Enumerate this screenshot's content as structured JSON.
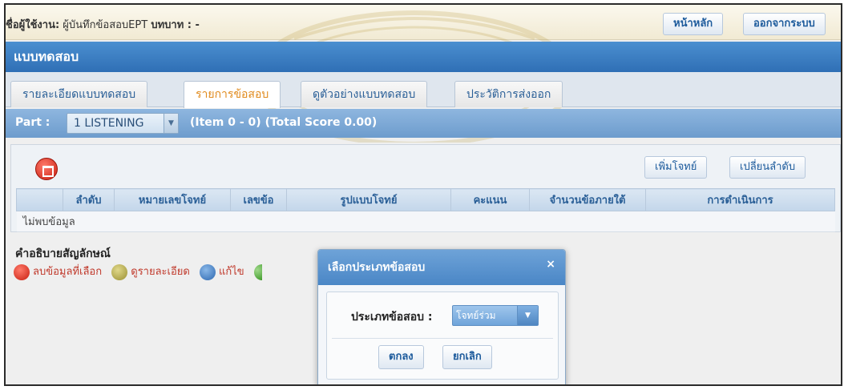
{
  "header": {
    "user_label": "ชื่อผู้ใช้งาน:",
    "user_name": "ผู้บันทึกข้อสอบEPT",
    "role_label": "บทบาท : -",
    "home_label": "หน้าหลัก",
    "logout_label": "ออกจากระบบ"
  },
  "page_title": "แบบทดสอบ",
  "tabs": [
    {
      "label": "รายละเอียดแบบทดสอบ",
      "active": false
    },
    {
      "label": "รายการข้อสอบ",
      "active": true
    },
    {
      "label": "ดูตัวอย่างแบบทดสอบ",
      "active": false
    },
    {
      "label": "ประวัติการส่งออก",
      "active": false
    }
  ],
  "part": {
    "label": "Part :",
    "selected": "1 LISTENING",
    "info": "(Item 0 - 0) (Total Score 0.00)"
  },
  "toolbar": {
    "add_label": "เพิ่มโจทย์",
    "reorder_label": "เปลี่ยนลำดับ"
  },
  "table": {
    "columns": [
      "",
      "ลำดับ",
      "หมายเลขโจทย์",
      "เลขข้อ",
      "รูปแบบโจทย์",
      "คะแนน",
      "จำนวนข้อภายใต้",
      "การดำเนินการ"
    ],
    "empty_text": "ไม่พบข้อมูล"
  },
  "legend": {
    "title": "คำอธิบายสัญลักษณ์",
    "items": [
      {
        "icon": "delete-icon",
        "label": "ลบข้อมูลที่เลือก"
      },
      {
        "icon": "view-details-icon",
        "label": "ดูรายละเอียด"
      },
      {
        "icon": "edit-icon",
        "label": "แก้ไข"
      }
    ]
  },
  "modal": {
    "title": "เลือกประเภทข้อสอบ",
    "close": "×",
    "field_label": "ประเภทข้อสอบ :",
    "selected": "โจทย์ร่วม",
    "ok_label": "ตกลง",
    "cancel_label": "ยกเลิก"
  }
}
